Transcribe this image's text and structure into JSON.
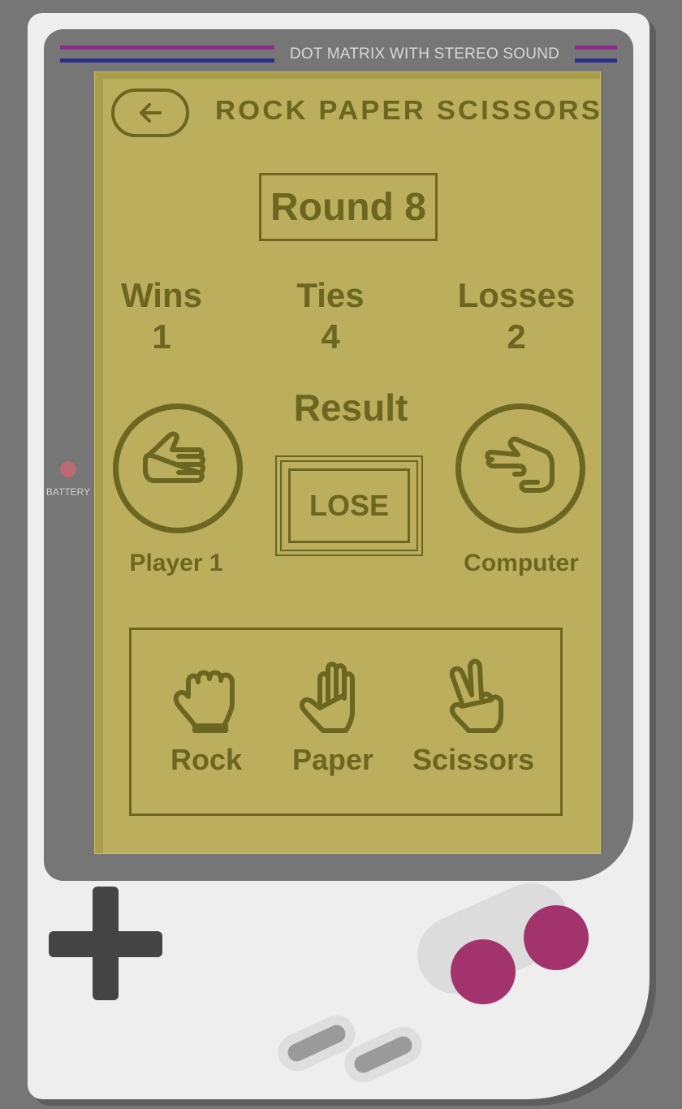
{
  "header": {
    "brand_text": "DOT MATRIX WITH STEREO SOUND",
    "battery_label": "BATTERY"
  },
  "game": {
    "title": "ROCK PAPER SCISSORS",
    "round_label": "Round 8",
    "stats": {
      "wins_label": "Wins",
      "wins": "1",
      "ties_label": "Ties",
      "ties": "4",
      "losses_label": "Losses",
      "losses": "2"
    },
    "result_label": "Result",
    "result_value": "LOSE",
    "player_label": "Player 1",
    "computer_label": "Computer",
    "player_choice_icon": "rock-hand-icon",
    "computer_choice_icon": "scissors-hand-icon"
  },
  "choices": [
    {
      "label": "Rock",
      "icon": "rock-icon"
    },
    {
      "label": "Paper",
      "icon": "paper-icon"
    },
    {
      "label": "Scissors",
      "icon": "scissors-icon"
    }
  ],
  "colors": {
    "screen": "#bbae5c",
    "ink": "#6b6620",
    "button": "#a3336d",
    "stripe_pink": "#8e2a8a",
    "stripe_blue": "#2d2d8a"
  }
}
